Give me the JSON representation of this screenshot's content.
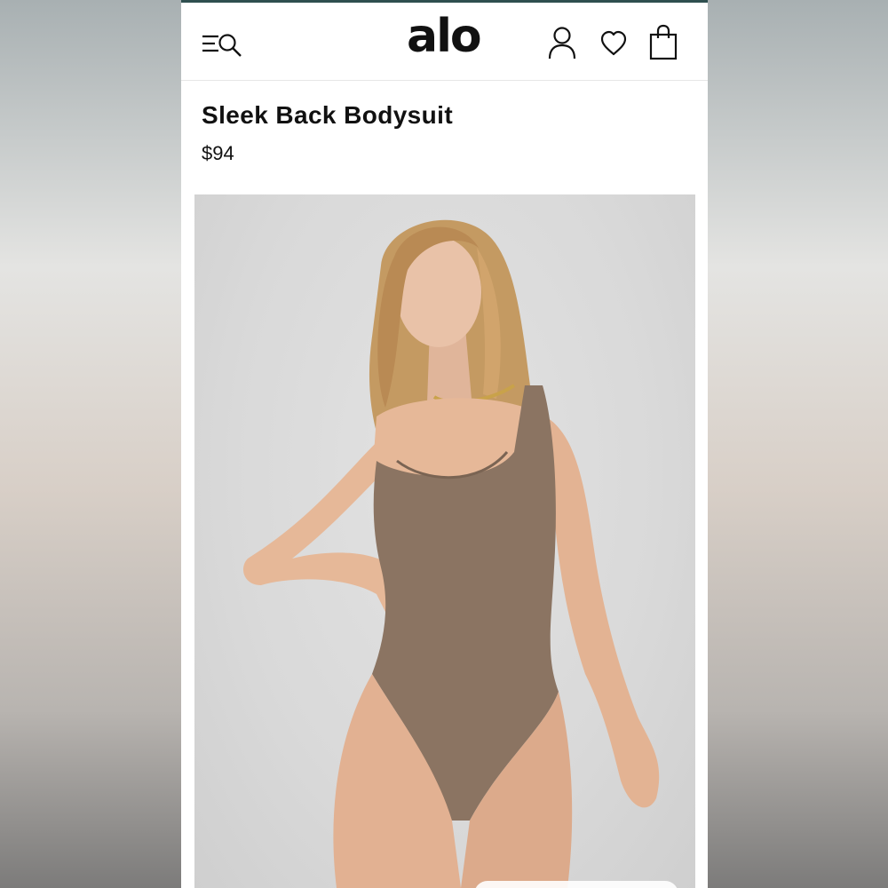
{
  "header": {
    "logo": "alo",
    "icons": [
      "menu-search-icon",
      "account-icon",
      "heart-icon",
      "shopping-bag-icon"
    ]
  },
  "product": {
    "name": "Sleek Back Bodysuit",
    "price": "$94"
  },
  "colors": {
    "topline": "#2f4f4f",
    "text": "#111111",
    "bodysuit": "#8b7462",
    "photo_bg": "#d9d9d9"
  }
}
